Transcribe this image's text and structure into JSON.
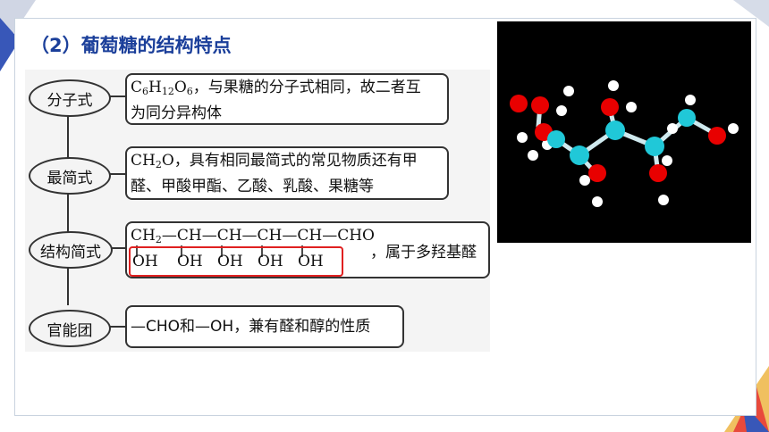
{
  "slide": {
    "title": "（2）葡萄糖的结构特点",
    "colors": {
      "title": "#1b3f9a",
      "highlight": "#e02020",
      "atom_o": "#e80000",
      "atom_c": "#20c8d8",
      "atom_h": "#ffffff"
    }
  },
  "rows": [
    {
      "label": "分子式",
      "text_line1_pre": "C",
      "formula_parts": [
        "6",
        "H",
        "12",
        "O",
        "6"
      ],
      "text_line1_post": "，与果糖的分子式相同，故二者互",
      "text_line2": "为同分异构体"
    },
    {
      "label": "最简式",
      "formula_pre": "CH",
      "formula_sub": "2",
      "formula_post": "O",
      "text_line1": "，具有相同最简式的常见物质还有甲",
      "text_line2": "醛、甲酸甲酯、乙酸、乳酸、果糖等"
    },
    {
      "label": "结构简式",
      "chain_start": "CH",
      "chain_start_sub": "2",
      "chain_units": [
        "—CH",
        "—CH",
        "—CH",
        "—CH",
        "—CHO"
      ],
      "oh_groups": [
        "OH",
        "OH",
        "OH",
        "OH",
        "OH"
      ],
      "suffix": "，属于多羟基醛"
    },
    {
      "label": "官能团",
      "text": "—CHO和—OH，兼有醛和醇的性质"
    }
  ]
}
